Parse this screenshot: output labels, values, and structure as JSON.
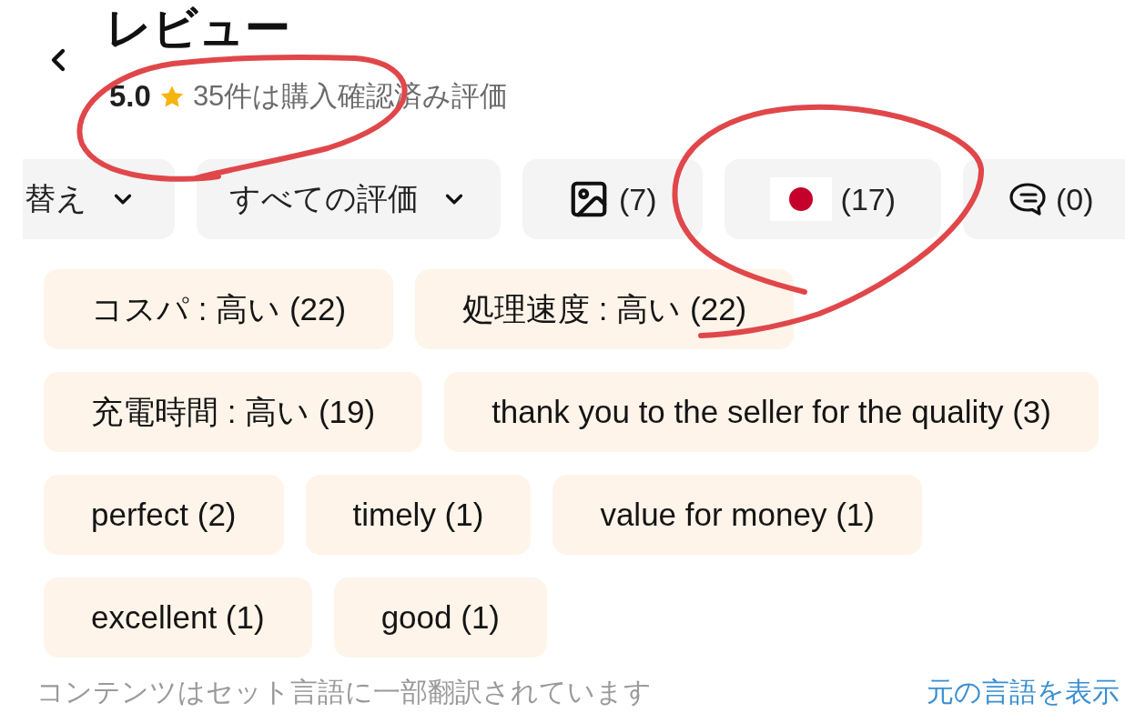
{
  "header": {
    "title": "レビュー"
  },
  "rating": {
    "score": "5.0",
    "summary": "35件は購入確認済み評価"
  },
  "filters": [
    {
      "kind": "dropdown",
      "label": "替え",
      "selected": false
    },
    {
      "kind": "dropdown",
      "label": "すべての評価",
      "selected": false
    },
    {
      "kind": "photo",
      "label": "(7)",
      "selected": false
    },
    {
      "kind": "flag",
      "label": "(17)",
      "selected": false
    },
    {
      "kind": "comment",
      "label": "(0)",
      "selected": false
    }
  ],
  "tags": [
    {
      "label": "コスパ : 高い (22)",
      "selected": false
    },
    {
      "label": "処理速度 : 高い (22)",
      "selected": false
    },
    {
      "label": "充電時間 : 高い (19)",
      "selected": false
    },
    {
      "label": "thank you to the seller for the quality (3)",
      "selected": false
    },
    {
      "label": "perfect (2)",
      "selected": false
    },
    {
      "label": "timely (1)",
      "selected": false
    },
    {
      "label": "value for money (1)",
      "selected": false
    },
    {
      "label": "excellent (1)",
      "selected": false
    },
    {
      "label": "good (1)",
      "selected": false
    }
  ],
  "footer": {
    "notice": "コンテンツはセット言語に一部翻訳されています",
    "link": "元の言語を表示"
  }
}
